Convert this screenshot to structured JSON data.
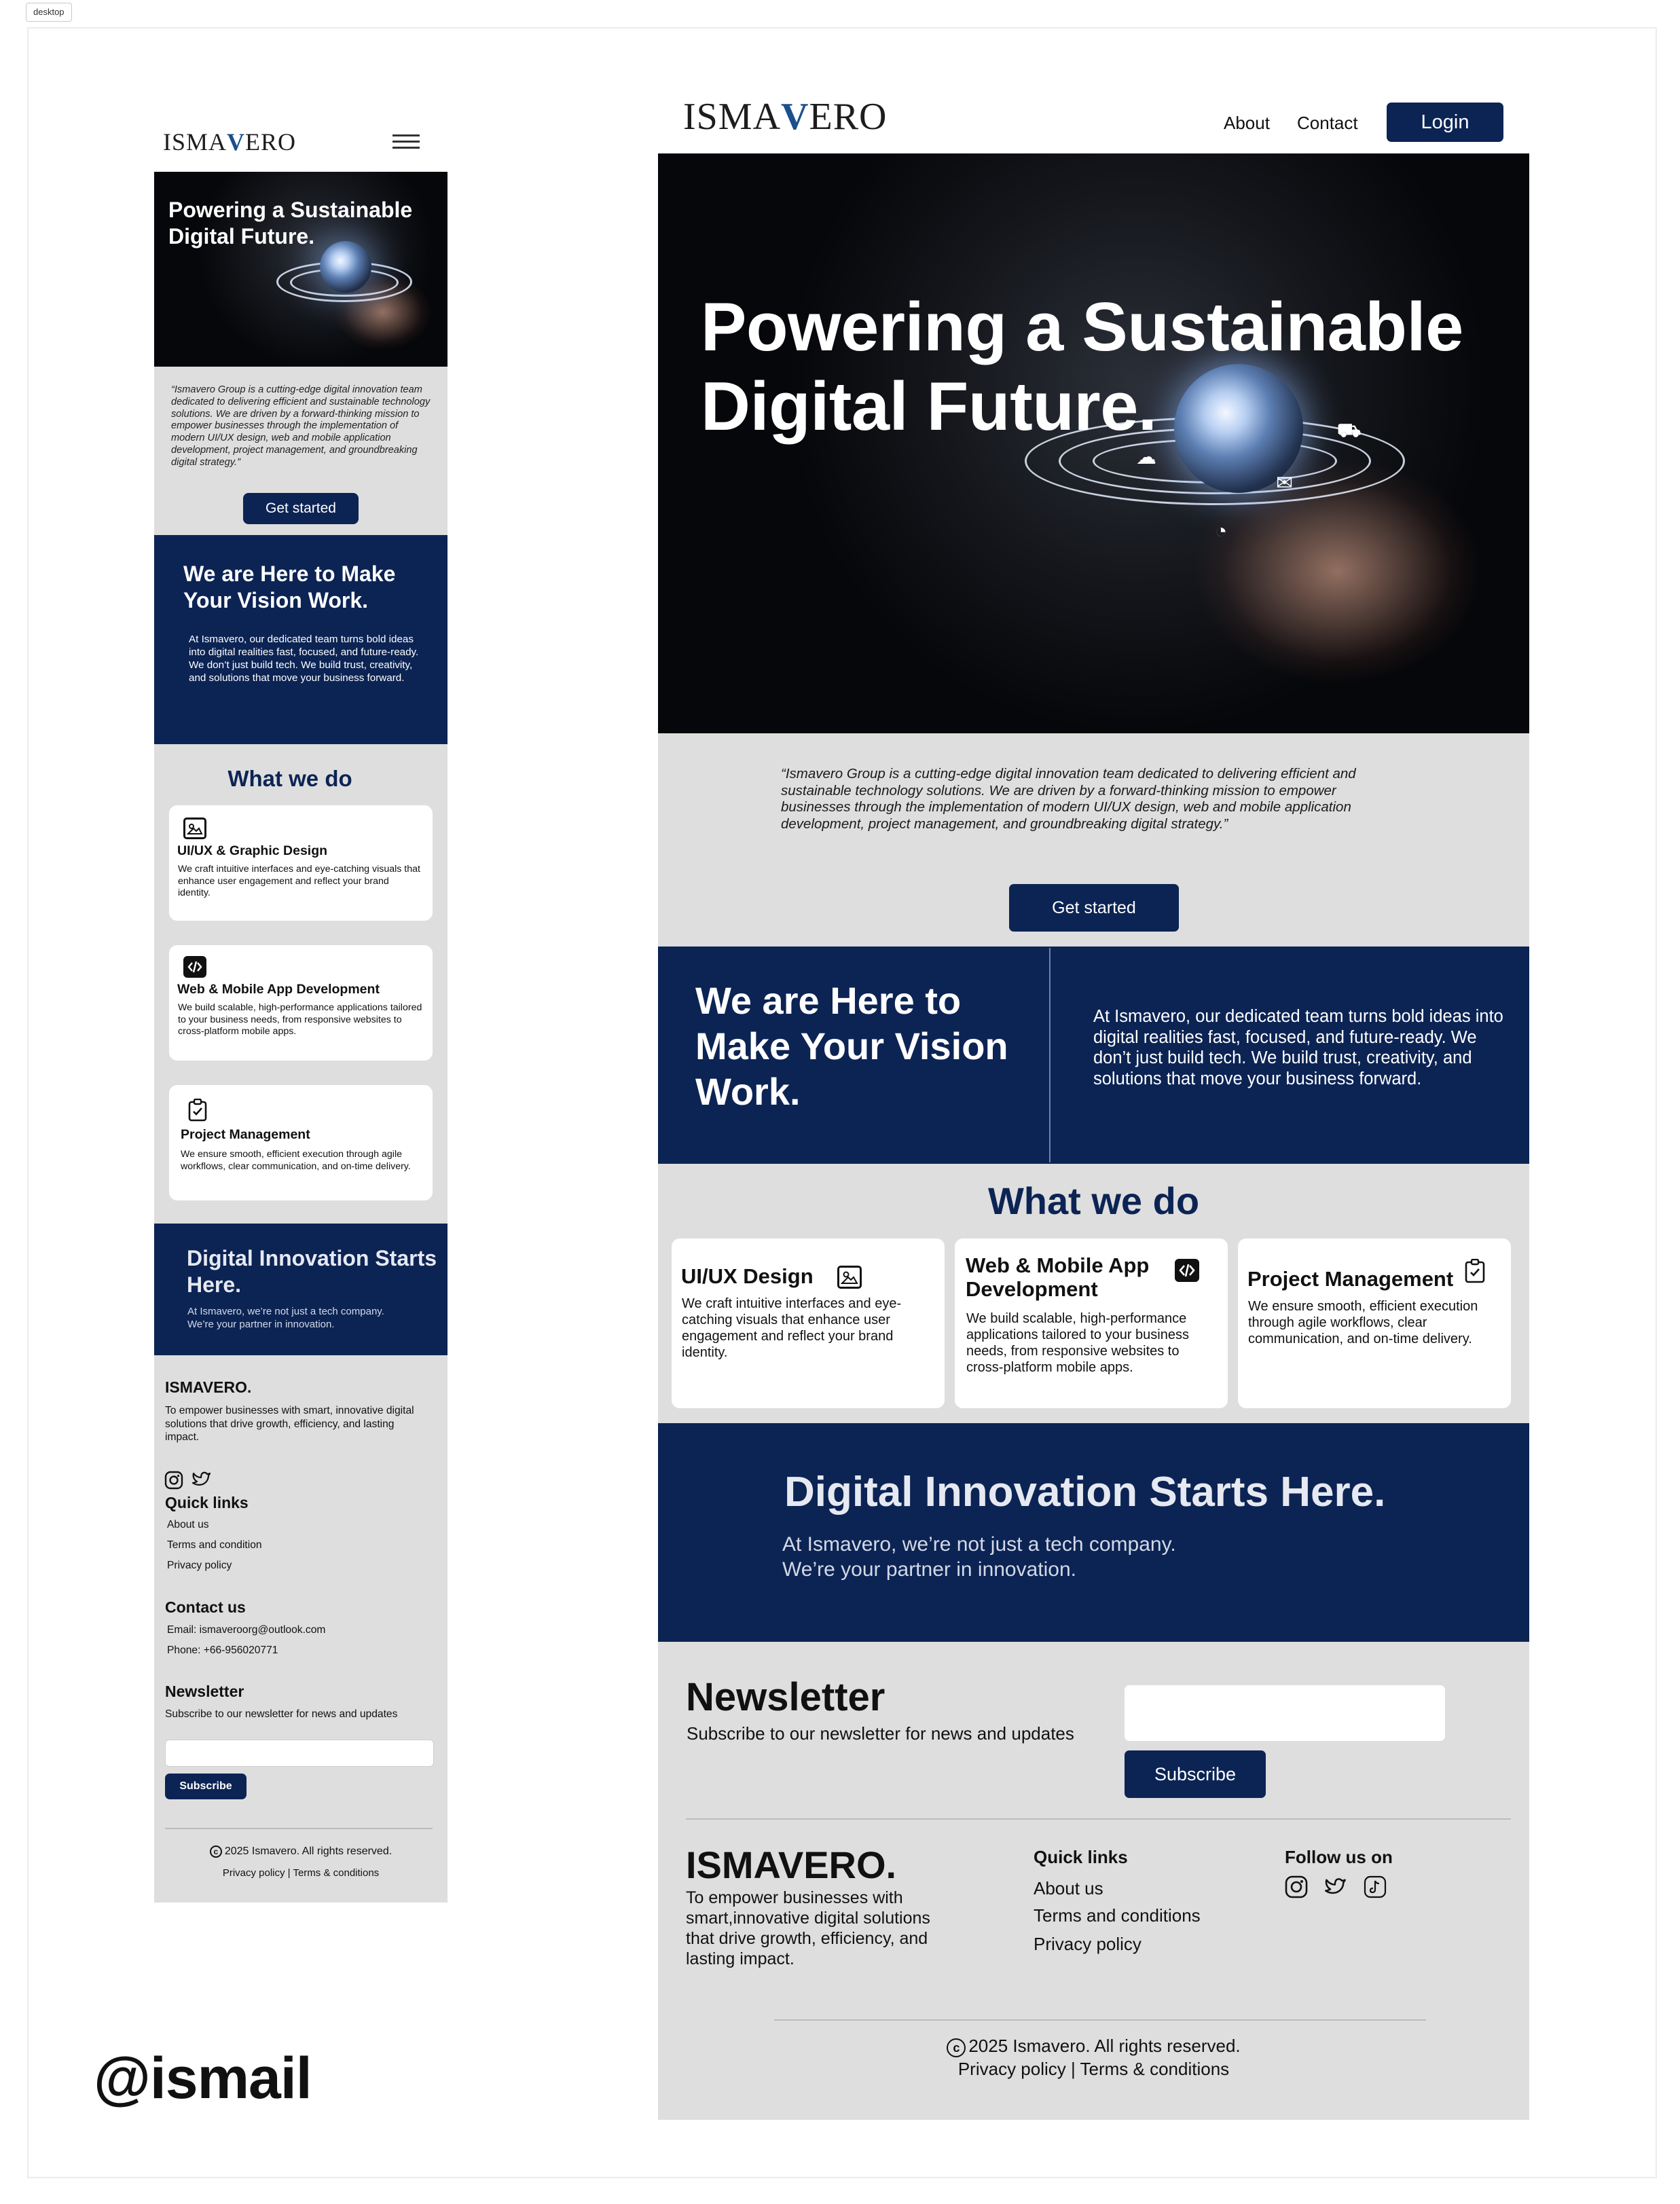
{
  "canvas": {
    "frame_label": "desktop",
    "author_handle": "@ismail"
  },
  "brand": {
    "logo_left": "ISMA",
    "logo_v": "V",
    "logo_right": "ERO",
    "footer_name": "ISMAVERO."
  },
  "colors": {
    "navy": "#0c2454",
    "section_grey": "#dedede",
    "logo_accent": "#1b4f8e"
  },
  "nav": {
    "about": "About",
    "contact": "Contact",
    "login": "Login",
    "menu_icon": "hamburger-icon"
  },
  "hero": {
    "title": "Powering a Sustainable Digital Future."
  },
  "intro": {
    "quote": "“Ismavero Group is a cutting-edge digital innovation team dedicated to delivering efficient and sustainable technology solutions. We are driven by a forward-thinking mission to empower businesses through the implementation of modern UI/UX design, web and mobile application development, project management, and groundbreaking digital strategy.”",
    "cta": "Get started"
  },
  "vision": {
    "title": "We are Here to Make Your Vision Work.",
    "body_1": "At Ismavero, our dedicated team turns bold ideas into digital realities fast, focused, and future-ready.",
    "body_2": "We don’t just build tech. We build trust, creativity, and solutions that move your business forward.",
    "body_desktop": "At Ismavero, our dedicated team turns bold ideas into digital realities fast, focused, and future-ready. We don’t just build tech. We build trust, creativity, and solutions that move your business forward."
  },
  "services": {
    "title": "What we do",
    "items": [
      {
        "mobile_title": "UI/UX & Graphic Design",
        "desktop_title": "UI/UX Design",
        "text": "We craft intuitive interfaces and eye-catching visuals that enhance user engagement and reflect your brand identity.",
        "icon": "image-gallery-icon"
      },
      {
        "mobile_title": "Web & Mobile App Development",
        "desktop_title": "Web & Mobile App Development",
        "text": "We build scalable, high-performance applications tailored to your business needs, from responsive websites to cross-platform mobile apps.",
        "icon": "code-icon"
      },
      {
        "mobile_title": "Project Management",
        "desktop_title": "Project Management",
        "text": "We ensure smooth, efficient execution through agile workflows, clear communication, and on-time delivery.",
        "icon": "clipboard-check-icon"
      }
    ]
  },
  "innovation": {
    "title": "Digital Innovation Starts Here.",
    "line_1": "At Ismavero, we’re not just a tech company.",
    "line_2": "We’re your partner in innovation."
  },
  "footer": {
    "mission_mobile": "To empower businesses with smart, innovative digital solutions that drive growth, efficiency, and lasting impact.",
    "mission_desktop": "To empower businesses with smart,innovative digital solutions that drive growth, efficiency, and lasting impact.",
    "quick_links_title": "Quick links",
    "links_mobile": [
      "About us",
      "Terms and condition",
      "Privacy policy"
    ],
    "links_desktop": [
      "About us",
      "Terms and conditions",
      "Privacy policy"
    ],
    "contact_title": "Contact us",
    "email": "Email: ismaveroorg@outlook.com",
    "phone": "Phone: +66-956020771",
    "follow_title": "Follow us on",
    "social_icons": [
      "instagram-icon",
      "twitter-icon",
      "tiktok-icon"
    ],
    "newsletter_title": "Newsletter",
    "newsletter_sub": "Subscribe to our newsletter for news and updates",
    "subscribe": "Subscribe",
    "copyright_symbol": "c",
    "copyright": "2025 Ismavero. All rights reserved.",
    "legal": "Privacy policy | Terms & conditions"
  }
}
